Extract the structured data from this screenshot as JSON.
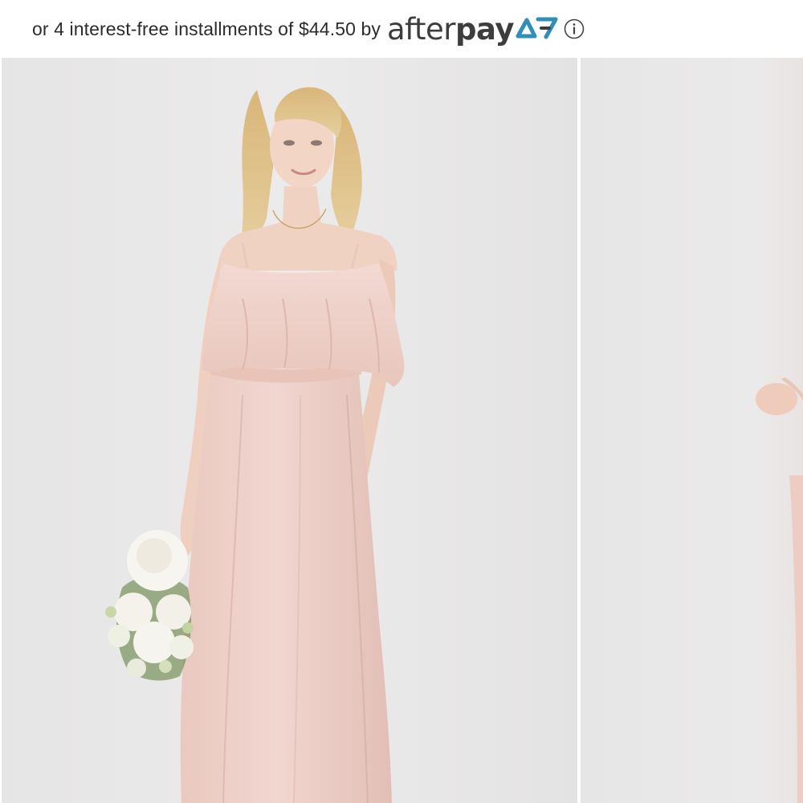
{
  "afterpay": {
    "installment_text": "or 4 interest-free installments of $44.50 by",
    "logo_light": "after",
    "logo_bold": "pay",
    "info_icon": "info-circle-icon"
  },
  "gallery": {
    "slides": [
      {
        "subject": "model-in-blush-cold-shoulder-maxi-dress-with-bouquet"
      },
      {
        "subject": "partial-view-of-model-next-image"
      }
    ]
  }
}
